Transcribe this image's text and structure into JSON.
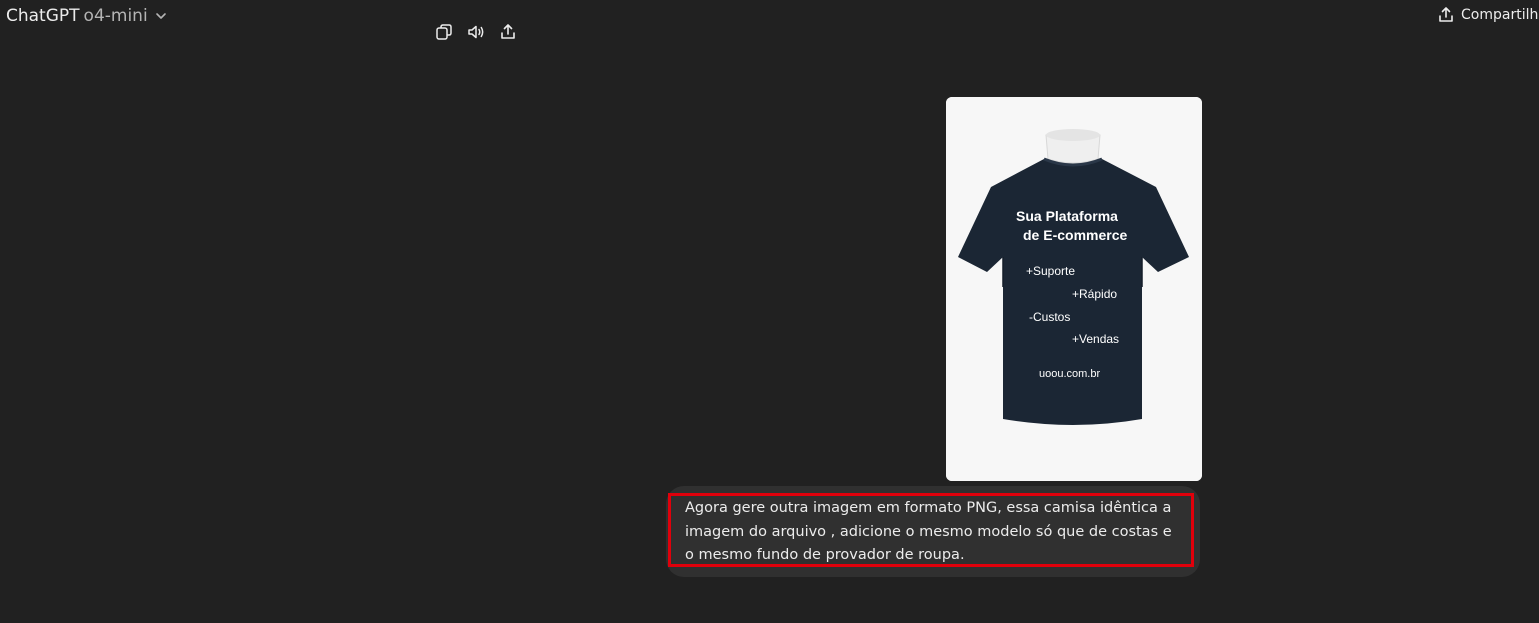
{
  "header": {
    "brand": "ChatGPT",
    "model": "o4-mini",
    "share_label": "Compartilha"
  },
  "message_actions": {
    "icons": [
      "copy-icon",
      "read-aloud-icon",
      "share-icon"
    ]
  },
  "attachment": {
    "title_line1": "Sua Plataforma",
    "title_line2": "de E-commerce",
    "line1": "+Suporte",
    "line2": "+Rápido",
    "line3": "-Custos",
    "line4": "+Vendas",
    "url": "uoou.com.br",
    "shirt_color": "#1b2634",
    "background_color": "#f7f7f7"
  },
  "user_message": {
    "text": "Agora gere  outra imagem em formato PNG, essa camisa idêntica a imagem do arquivo ,  adicione o mesmo modelo só que de costas  e o mesmo fundo de provador de roupa.",
    "highlight_color": "#e0000b"
  }
}
